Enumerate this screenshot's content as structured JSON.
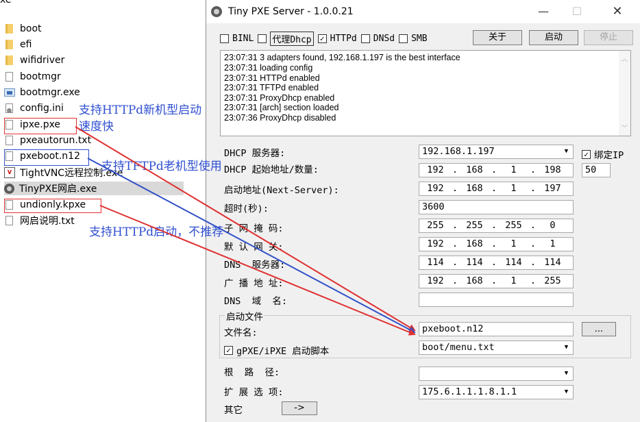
{
  "explorer": {
    "partial_top": "xe",
    "items": [
      {
        "name": "boot",
        "icon": "folder-icon"
      },
      {
        "name": "efi",
        "icon": "folder-icon"
      },
      {
        "name": "wifidriver",
        "icon": "folder-icon"
      },
      {
        "name": "bootmgr",
        "icon": "file-icon"
      },
      {
        "name": "bootmgr.exe",
        "icon": "exe-icon"
      },
      {
        "name": "config.ini",
        "icon": "config-file-icon"
      },
      {
        "name": "ipxe.pxe",
        "icon": "file-icon"
      },
      {
        "name": "pxeautorun.txt",
        "icon": "file-icon"
      },
      {
        "name": "pxeboot.n12",
        "icon": "file-icon"
      },
      {
        "name": "TightVNC远程控制.exe",
        "icon": "vnc-icon"
      },
      {
        "name": "TinyPXE网启.exe",
        "icon": "tinypxe-icon"
      },
      {
        "name": "undionly.kpxe",
        "icon": "file-icon"
      },
      {
        "name": "网启说明.txt",
        "icon": "file-icon"
      }
    ]
  },
  "annotations": {
    "ipxe_note_line1": "支持HTTPd新机型启动",
    "ipxe_note_line2": "速度快",
    "pxeboot_note": "支持TFTPd老机型使用",
    "undionly_note": "支持HTTPd启动，不推荐",
    "colors": {
      "red": "#e03030",
      "blue": "#3050c8",
      "text_blue": "#2f4fd0"
    }
  },
  "window": {
    "title": "Tiny PXE Server - 1.0.0.21",
    "controls": {
      "minimize": "—",
      "maximize": "☐",
      "close": "✕"
    }
  },
  "options": {
    "binl": {
      "label": "BINL",
      "checked": false
    },
    "proxy_dhcp": {
      "label": "代理Dhcp",
      "checked": false
    },
    "httpd": {
      "label": "HTTPd",
      "checked": true
    },
    "dnsd": {
      "label": "DNSd",
      "checked": false
    },
    "smb": {
      "label": "SMB",
      "checked": false
    }
  },
  "buttons": {
    "about": "关于",
    "start": "启动",
    "stop": "停止"
  },
  "log": [
    "23:07:31 3 adapters found, 192.168.1.197 is the best interface",
    "23:07:31 loading config",
    "23:07:31 HTTPd enabled",
    "23:07:31 TFTPd enabled",
    "23:07:31 ProxyDhcp enabled",
    "23:07:31 [arch] section loaded",
    "23:07:36 ProxyDhcp disabled"
  ],
  "form": {
    "dhcp_server_label": "DHCP 服务器:",
    "dhcp_server_value": "192.168.1.197",
    "bind_ip_label": "绑定IP",
    "bind_ip_checked": true,
    "dhcp_start_label": "DHCP 起始地址/数量:",
    "dhcp_start_ip": [
      "192",
      "168",
      "1",
      "198"
    ],
    "dhcp_count": "50",
    "next_server_label": "启动地址(Next-Server):",
    "next_server_ip": [
      "192",
      "168",
      "1",
      "197"
    ],
    "timeout_label": "超时(秒):",
    "timeout_value": "3600",
    "subnet_label": "子 网 掩 码:",
    "subnet_ip": [
      "255",
      "255",
      "255",
      "0"
    ],
    "gateway_label": "默 认 网 关:",
    "gateway_ip": [
      "192",
      "168",
      "1",
      "1"
    ],
    "dns_label": "DNS  服务器:",
    "dns_ip": [
      "114",
      "114",
      "114",
      "114"
    ],
    "broadcast_label": "广 播 地 址:",
    "broadcast_ip": [
      "192",
      "168",
      "1",
      "255"
    ],
    "domain_label": "DNS  域  名:",
    "domain_value": "",
    "boot_group_title": "启动文件",
    "filename_label": "文件名:",
    "filename_value": "pxeboot.n12",
    "browse_label": "...",
    "gpxe_label": "gPXE/iPXE 启动脚本",
    "gpxe_checked": true,
    "gpxe_script": "boot/menu.txt",
    "root_path_label": "根  路  径:",
    "root_path_value": "",
    "ext_options_label": "扩 展 选 项:",
    "ext_options_value": "175.6.1.1.1.8.1.1",
    "other_label": "其它",
    "other_button": "->"
  }
}
